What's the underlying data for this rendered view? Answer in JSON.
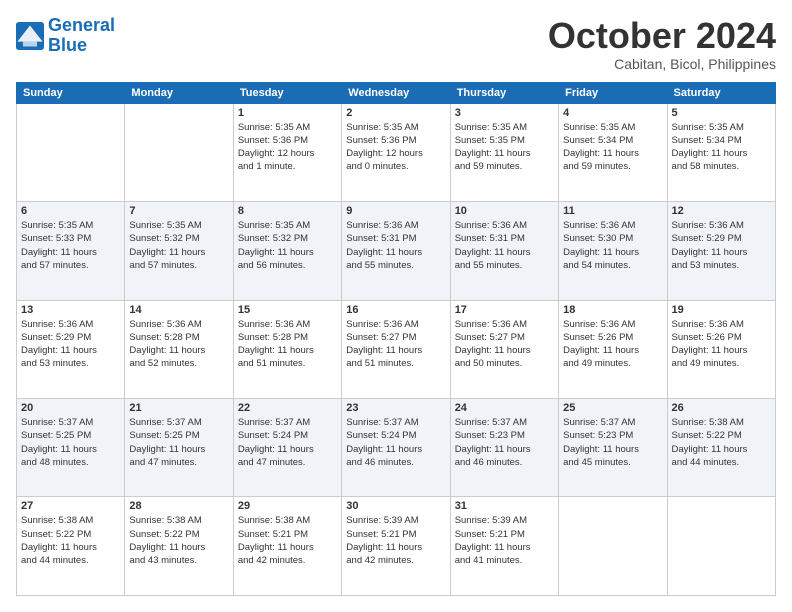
{
  "logo": {
    "line1": "General",
    "line2": "Blue"
  },
  "title": "October 2024",
  "location": "Cabitan, Bicol, Philippines",
  "weekdays": [
    "Sunday",
    "Monday",
    "Tuesday",
    "Wednesday",
    "Thursday",
    "Friday",
    "Saturday"
  ],
  "weeks": [
    [
      {
        "day": "",
        "info": ""
      },
      {
        "day": "",
        "info": ""
      },
      {
        "day": "1",
        "info": "Sunrise: 5:35 AM\nSunset: 5:36 PM\nDaylight: 12 hours\nand 1 minute."
      },
      {
        "day": "2",
        "info": "Sunrise: 5:35 AM\nSunset: 5:36 PM\nDaylight: 12 hours\nand 0 minutes."
      },
      {
        "day": "3",
        "info": "Sunrise: 5:35 AM\nSunset: 5:35 PM\nDaylight: 11 hours\nand 59 minutes."
      },
      {
        "day": "4",
        "info": "Sunrise: 5:35 AM\nSunset: 5:34 PM\nDaylight: 11 hours\nand 59 minutes."
      },
      {
        "day": "5",
        "info": "Sunrise: 5:35 AM\nSunset: 5:34 PM\nDaylight: 11 hours\nand 58 minutes."
      }
    ],
    [
      {
        "day": "6",
        "info": "Sunrise: 5:35 AM\nSunset: 5:33 PM\nDaylight: 11 hours\nand 57 minutes."
      },
      {
        "day": "7",
        "info": "Sunrise: 5:35 AM\nSunset: 5:32 PM\nDaylight: 11 hours\nand 57 minutes."
      },
      {
        "day": "8",
        "info": "Sunrise: 5:35 AM\nSunset: 5:32 PM\nDaylight: 11 hours\nand 56 minutes."
      },
      {
        "day": "9",
        "info": "Sunrise: 5:36 AM\nSunset: 5:31 PM\nDaylight: 11 hours\nand 55 minutes."
      },
      {
        "day": "10",
        "info": "Sunrise: 5:36 AM\nSunset: 5:31 PM\nDaylight: 11 hours\nand 55 minutes."
      },
      {
        "day": "11",
        "info": "Sunrise: 5:36 AM\nSunset: 5:30 PM\nDaylight: 11 hours\nand 54 minutes."
      },
      {
        "day": "12",
        "info": "Sunrise: 5:36 AM\nSunset: 5:29 PM\nDaylight: 11 hours\nand 53 minutes."
      }
    ],
    [
      {
        "day": "13",
        "info": "Sunrise: 5:36 AM\nSunset: 5:29 PM\nDaylight: 11 hours\nand 53 minutes."
      },
      {
        "day": "14",
        "info": "Sunrise: 5:36 AM\nSunset: 5:28 PM\nDaylight: 11 hours\nand 52 minutes."
      },
      {
        "day": "15",
        "info": "Sunrise: 5:36 AM\nSunset: 5:28 PM\nDaylight: 11 hours\nand 51 minutes."
      },
      {
        "day": "16",
        "info": "Sunrise: 5:36 AM\nSunset: 5:27 PM\nDaylight: 11 hours\nand 51 minutes."
      },
      {
        "day": "17",
        "info": "Sunrise: 5:36 AM\nSunset: 5:27 PM\nDaylight: 11 hours\nand 50 minutes."
      },
      {
        "day": "18",
        "info": "Sunrise: 5:36 AM\nSunset: 5:26 PM\nDaylight: 11 hours\nand 49 minutes."
      },
      {
        "day": "19",
        "info": "Sunrise: 5:36 AM\nSunset: 5:26 PM\nDaylight: 11 hours\nand 49 minutes."
      }
    ],
    [
      {
        "day": "20",
        "info": "Sunrise: 5:37 AM\nSunset: 5:25 PM\nDaylight: 11 hours\nand 48 minutes."
      },
      {
        "day": "21",
        "info": "Sunrise: 5:37 AM\nSunset: 5:25 PM\nDaylight: 11 hours\nand 47 minutes."
      },
      {
        "day": "22",
        "info": "Sunrise: 5:37 AM\nSunset: 5:24 PM\nDaylight: 11 hours\nand 47 minutes."
      },
      {
        "day": "23",
        "info": "Sunrise: 5:37 AM\nSunset: 5:24 PM\nDaylight: 11 hours\nand 46 minutes."
      },
      {
        "day": "24",
        "info": "Sunrise: 5:37 AM\nSunset: 5:23 PM\nDaylight: 11 hours\nand 46 minutes."
      },
      {
        "day": "25",
        "info": "Sunrise: 5:37 AM\nSunset: 5:23 PM\nDaylight: 11 hours\nand 45 minutes."
      },
      {
        "day": "26",
        "info": "Sunrise: 5:38 AM\nSunset: 5:22 PM\nDaylight: 11 hours\nand 44 minutes."
      }
    ],
    [
      {
        "day": "27",
        "info": "Sunrise: 5:38 AM\nSunset: 5:22 PM\nDaylight: 11 hours\nand 44 minutes."
      },
      {
        "day": "28",
        "info": "Sunrise: 5:38 AM\nSunset: 5:22 PM\nDaylight: 11 hours\nand 43 minutes."
      },
      {
        "day": "29",
        "info": "Sunrise: 5:38 AM\nSunset: 5:21 PM\nDaylight: 11 hours\nand 42 minutes."
      },
      {
        "day": "30",
        "info": "Sunrise: 5:39 AM\nSunset: 5:21 PM\nDaylight: 11 hours\nand 42 minutes."
      },
      {
        "day": "31",
        "info": "Sunrise: 5:39 AM\nSunset: 5:21 PM\nDaylight: 11 hours\nand 41 minutes."
      },
      {
        "day": "",
        "info": ""
      },
      {
        "day": "",
        "info": ""
      }
    ]
  ]
}
